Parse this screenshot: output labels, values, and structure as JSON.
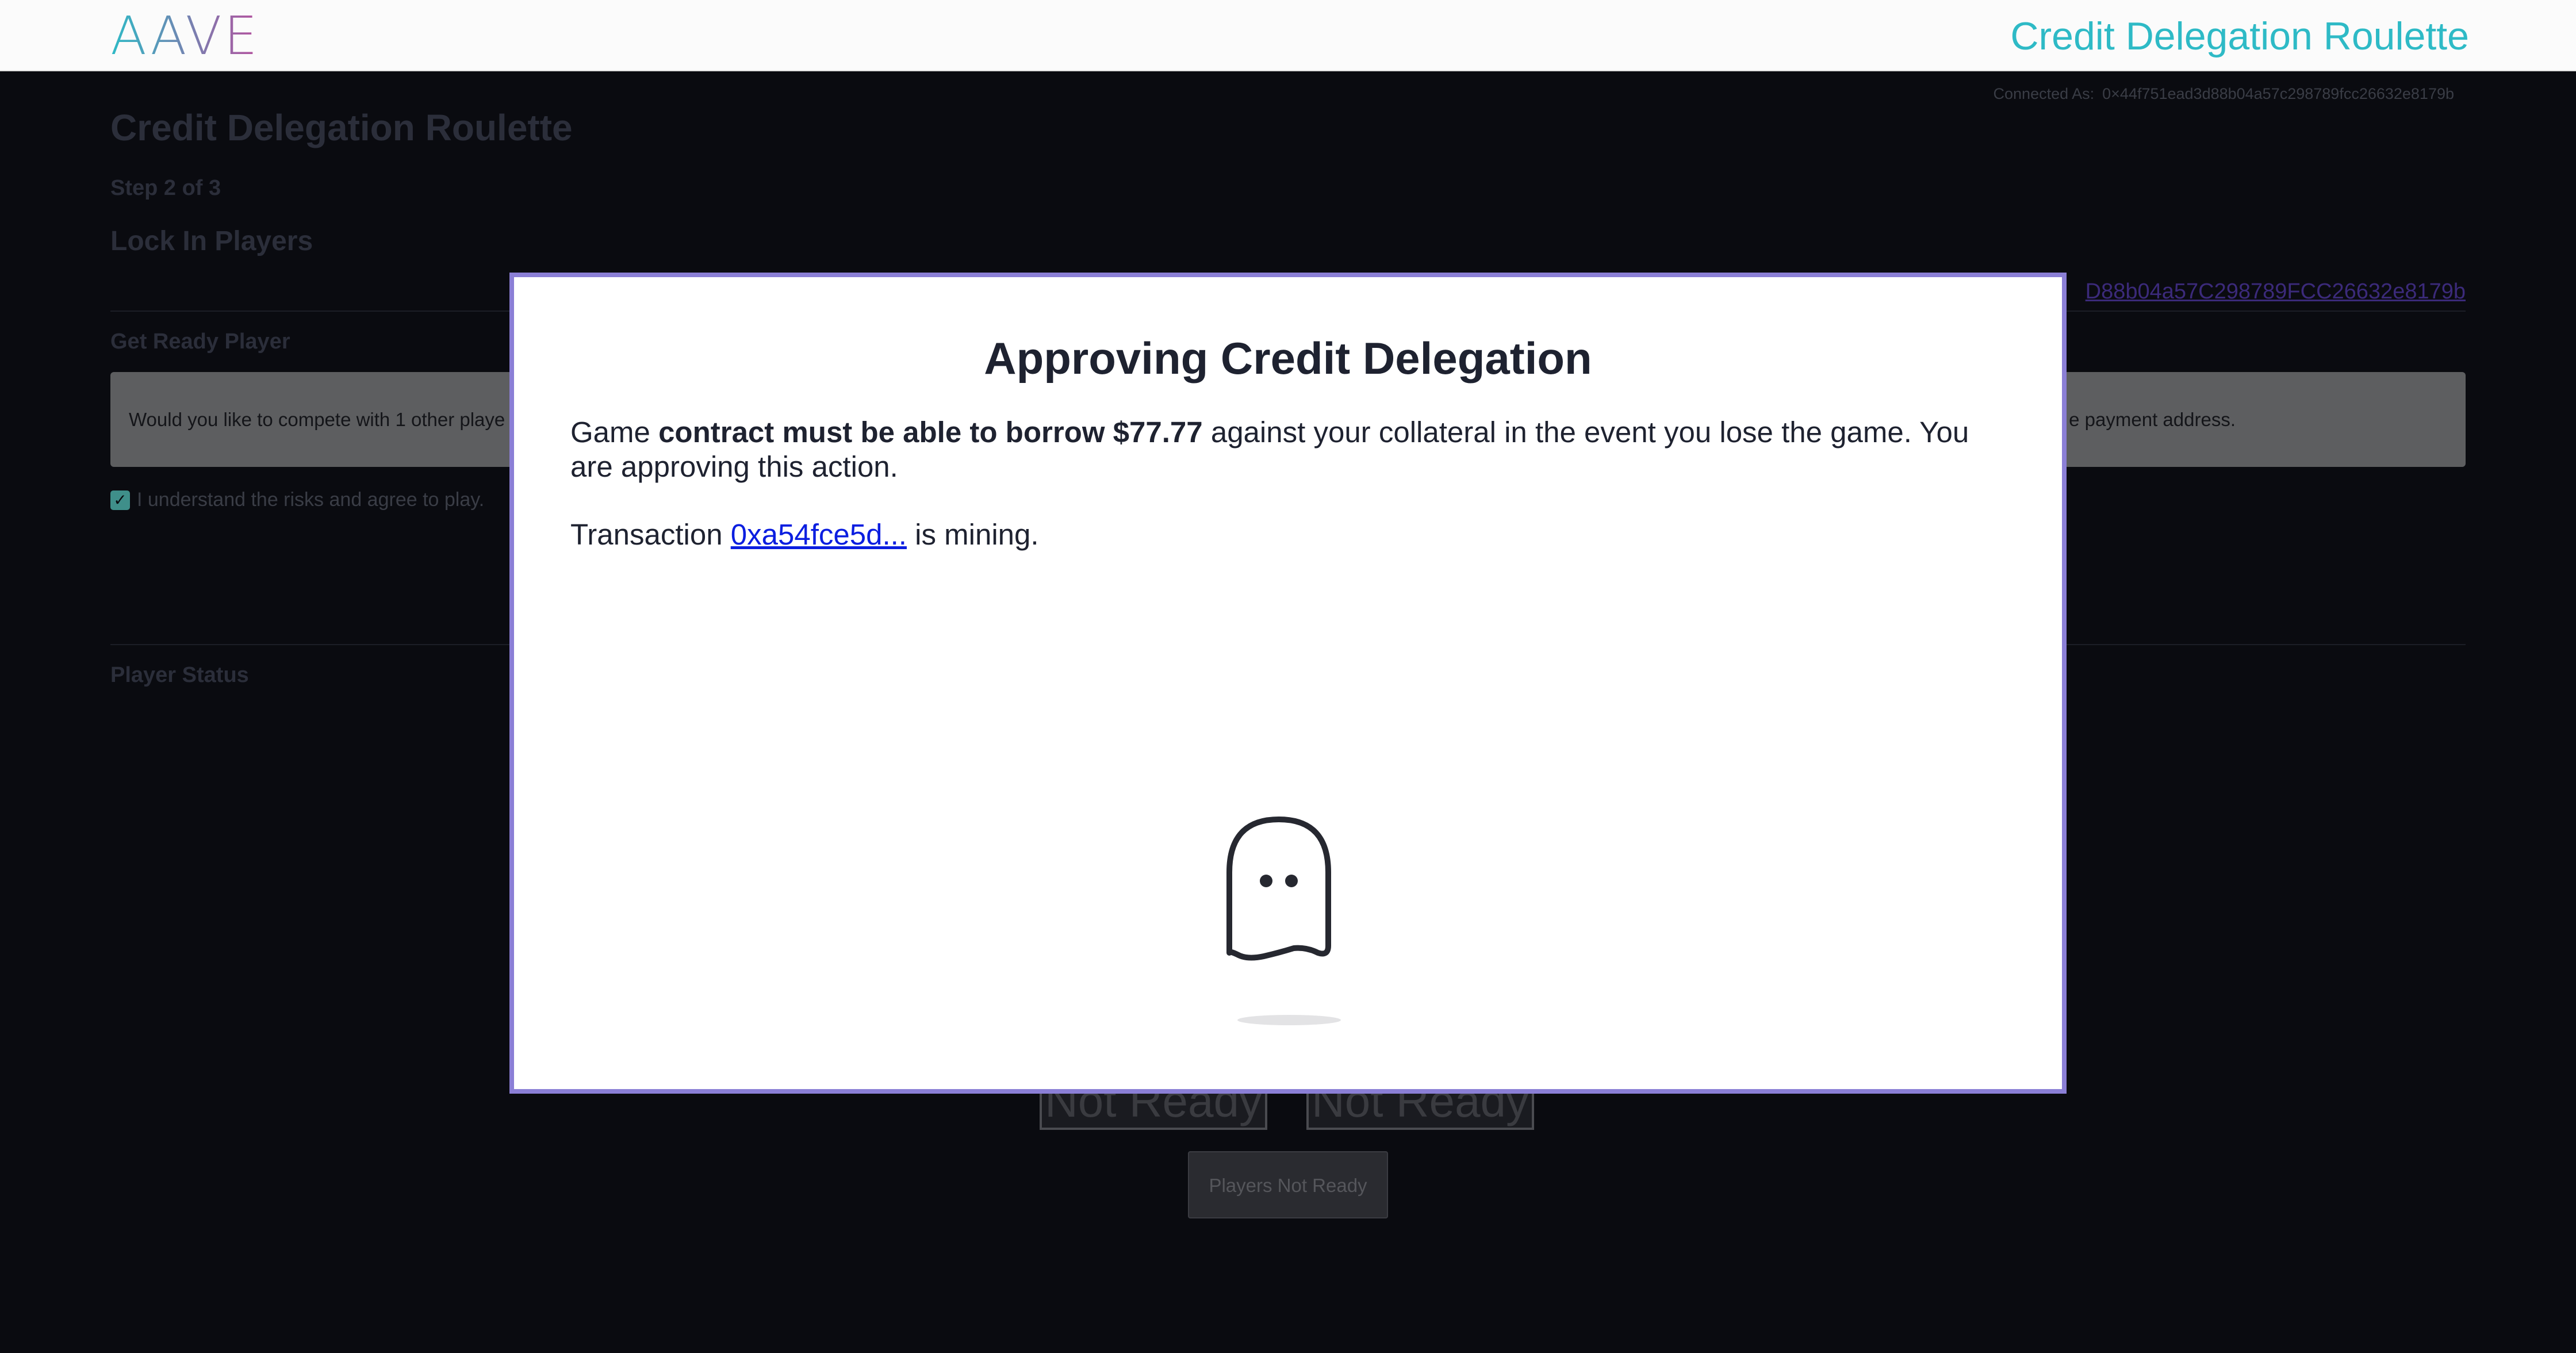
{
  "header": {
    "logo_text": "AAVE",
    "app_title": "Credit Delegation Roulette",
    "connected_label": "Connected As:",
    "connected_address": "0×44f751ead3d88b04a57c298789fcc26632e8179b"
  },
  "page": {
    "title": "Credit Delegation Roulette",
    "step": "Step 2 of 3",
    "section_title": "Lock In Players",
    "address_link": "D88b04a57C298789FCC26632e8179b",
    "get_ready_title": "Get Ready Player",
    "info_text_left": "Would you like to compete with 1 other playe",
    "info_text_right": "e payment address.",
    "agree_label": "I understand the risks and agree to play.",
    "agree_checked": true,
    "player_status_title": "Player Status",
    "player_badges": [
      "Not Ready",
      "Not Ready"
    ],
    "players_button": "Players Not Ready"
  },
  "modal": {
    "title": "Approving Credit Delegation",
    "body_prefix": "Game ",
    "body_bold": "contract must be able to borrow $77.77",
    "body_suffix": " against your collateral in the event you lose the game. You are approving this action.",
    "tx_prefix": "Transaction ",
    "tx_link": "0xa54fce5d...",
    "tx_suffix": " is mining.",
    "loader_icon": "ghost-icon"
  },
  "colors": {
    "modal_border": "#8b7fd6",
    "link": "#0b1ee0",
    "aave_teal": "#2ebac6",
    "aave_purple": "#b6509e"
  }
}
